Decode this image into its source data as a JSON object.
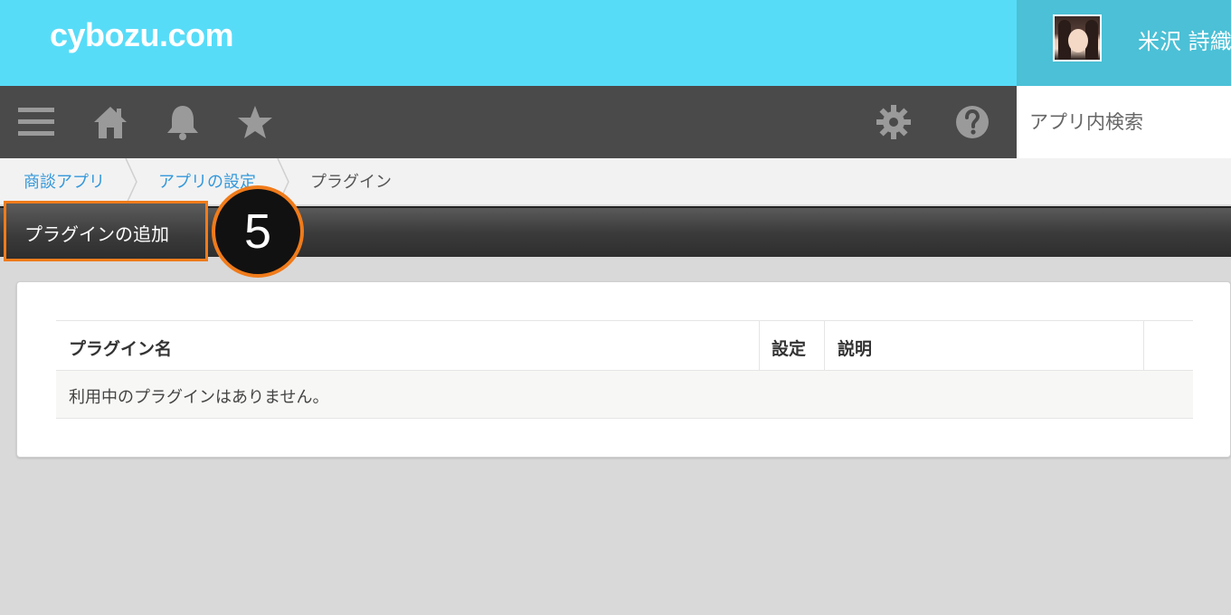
{
  "header": {
    "logo": "cybozu.com",
    "user_name": "米沢 詩織"
  },
  "toolbar": {
    "icons": [
      "menu-icon",
      "home-icon",
      "bell-icon",
      "star-icon",
      "gear-icon",
      "help-icon"
    ],
    "search_placeholder": "アプリ内検索"
  },
  "breadcrumb": {
    "items": [
      {
        "label": "商談アプリ"
      },
      {
        "label": "アプリの設定"
      },
      {
        "label": "プラグイン"
      }
    ]
  },
  "action": {
    "add_plugin_label": "プラグインの追加",
    "step_number": "5"
  },
  "table": {
    "headers": {
      "name": "プラグイン名",
      "settings": "設定",
      "description": "説明"
    },
    "empty_message": "利用中のプラグインはありません。"
  },
  "colors": {
    "header_bg": "#57dcf8",
    "user_panel_bg": "#4bc0d6",
    "toolbar_bg": "#4a4a4a",
    "highlight": "#f07b1a",
    "link": "#3498db"
  }
}
